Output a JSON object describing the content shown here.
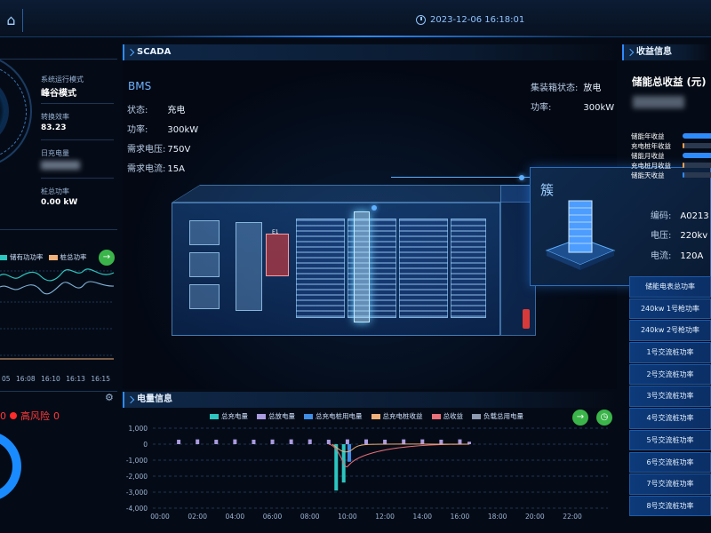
{
  "header": {
    "datetime": "2023-12-06 16:18:01"
  },
  "left": {
    "mode_label": "系统运行模式",
    "mode_value": "峰谷模式",
    "eff_label": "转换效率",
    "eff_value": "83.23",
    "daily_label": "日充电量",
    "pile_label": "桩总功率",
    "pile_value": "0.00 kW",
    "legend": [
      "储有功功率",
      "桩总功率"
    ],
    "xticks": [
      "05",
      "16:08",
      "16:10",
      "16:13",
      "16:15"
    ],
    "risk_count": "0",
    "risk_label": "高风险",
    "risk_value": "0"
  },
  "scada": {
    "title": "SCADA",
    "bms": "BMS",
    "state_label": "状态:",
    "state_value": "充电",
    "power_label": "功率:",
    "power_value": "300kW",
    "voltage_label": "需求电压:",
    "voltage_value": "750V",
    "current_label": "需求电流:",
    "current_value": "15A",
    "container_state_label": "集装箱状态:",
    "container_state_value": "放电",
    "container_power_label": "功率:",
    "container_power_value": "300kW",
    "cabinet_tag": "E1"
  },
  "card": {
    "title": "簇",
    "code_label": "编码:",
    "code_value": "A0213",
    "voltage_label": "电压:",
    "voltage_value": "220kv",
    "current_label": "电流:",
    "current_value": "120A"
  },
  "power": {
    "title": "电量信息",
    "legend": [
      {
        "name": "总充电量",
        "color": "#2cc6c0"
      },
      {
        "name": "总放电量",
        "color": "#a99be0"
      },
      {
        "name": "总充电桩用电量",
        "color": "#3f8ee6"
      },
      {
        "name": "总充电桩收益",
        "color": "#f0b07a"
      },
      {
        "name": "总收益",
        "color": "#e8707a"
      },
      {
        "name": "负载总用电量",
        "color": "#8e9ab0"
      }
    ]
  },
  "revenue": {
    "header": "收益信息",
    "title": "储能总收益 (元)",
    "rows": [
      {
        "label": "储能年收益",
        "fill": 0.92,
        "color": "#2e8bff"
      },
      {
        "label": "充电桩年收益",
        "fill": 0.06,
        "color": "#f0a050"
      },
      {
        "label": "储能月收益",
        "fill": 0.9,
        "color": "#2e8bff"
      },
      {
        "label": "充电桩月收益",
        "fill": 0.06,
        "color": "#f0a050"
      },
      {
        "label": "储能天收益",
        "fill": 0.05,
        "color": "#2e8bff"
      }
    ],
    "table": [
      "储能电表总功率",
      "240kw 1号枪功率",
      "240kw 2号枪功率",
      "1号交流桩功率",
      "2号交流桩功率",
      "3号交流桩功率",
      "4号交流桩功率",
      "5号交流桩功率",
      "6号交流桩功率",
      "7号交流桩功率",
      "8号交流桩功率"
    ]
  },
  "chart_data": {
    "type": "bar",
    "x": [
      "00:00",
      "02:00",
      "04:00",
      "06:00",
      "08:00",
      "10:00",
      "12:00",
      "14:00",
      "16:00",
      "18:00",
      "20:00",
      "22:00"
    ],
    "ylim": [
      -4000,
      1000
    ],
    "yticks": [
      "1,000",
      "0",
      "-1,000",
      "-2,000",
      "-3,000",
      "-4,000"
    ],
    "series": [
      {
        "name": "总放电量",
        "hours": [
          1,
          2,
          3,
          4,
          5,
          6,
          7,
          8,
          9,
          10,
          11,
          12,
          13,
          14,
          15,
          16,
          16.5
        ],
        "values": [
          280,
          300,
          280,
          300,
          280,
          290,
          300,
          300,
          280,
          300,
          300,
          280,
          300,
          300,
          280,
          300,
          150
        ]
      },
      {
        "name": "总充电量",
        "hours": [
          9.4,
          9.8
        ],
        "values": [
          -2900,
          -2400
        ]
      },
      {
        "name": "总充电桩用电量",
        "hours": [
          10.1
        ],
        "values": [
          -1100
        ]
      }
    ]
  }
}
